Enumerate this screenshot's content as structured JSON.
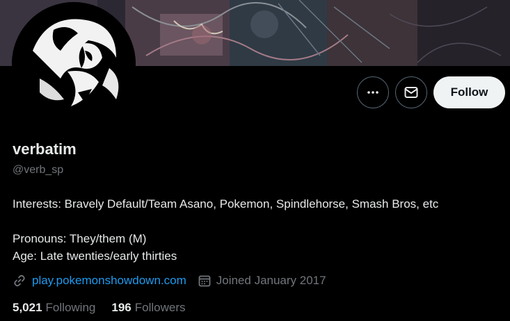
{
  "profile": {
    "display_name": "verbatim",
    "handle": "@verb_sp",
    "bio_lines": [
      "Interests: Bravely Default/Team Asano, Pokemon, Spindlehorse, Smash Bros, etc",
      "Pronouns: They/them (M)",
      "Age: Late twenties/early thirties"
    ],
    "website": "play.pokemonshowdown.com",
    "joined": "Joined January 2017"
  },
  "actions": {
    "follow_label": "Follow",
    "more_icon": "more-dots-icon",
    "message_icon": "mail-icon"
  },
  "stats": {
    "following_count": "5,021",
    "following_label": "Following",
    "followers_count": "196",
    "followers_label": "Followers"
  },
  "colors": {
    "background": "#000000",
    "accent_link": "#1d9bf0",
    "secondary_text": "#71767b",
    "follow_button_bg": "#eff3f4"
  }
}
